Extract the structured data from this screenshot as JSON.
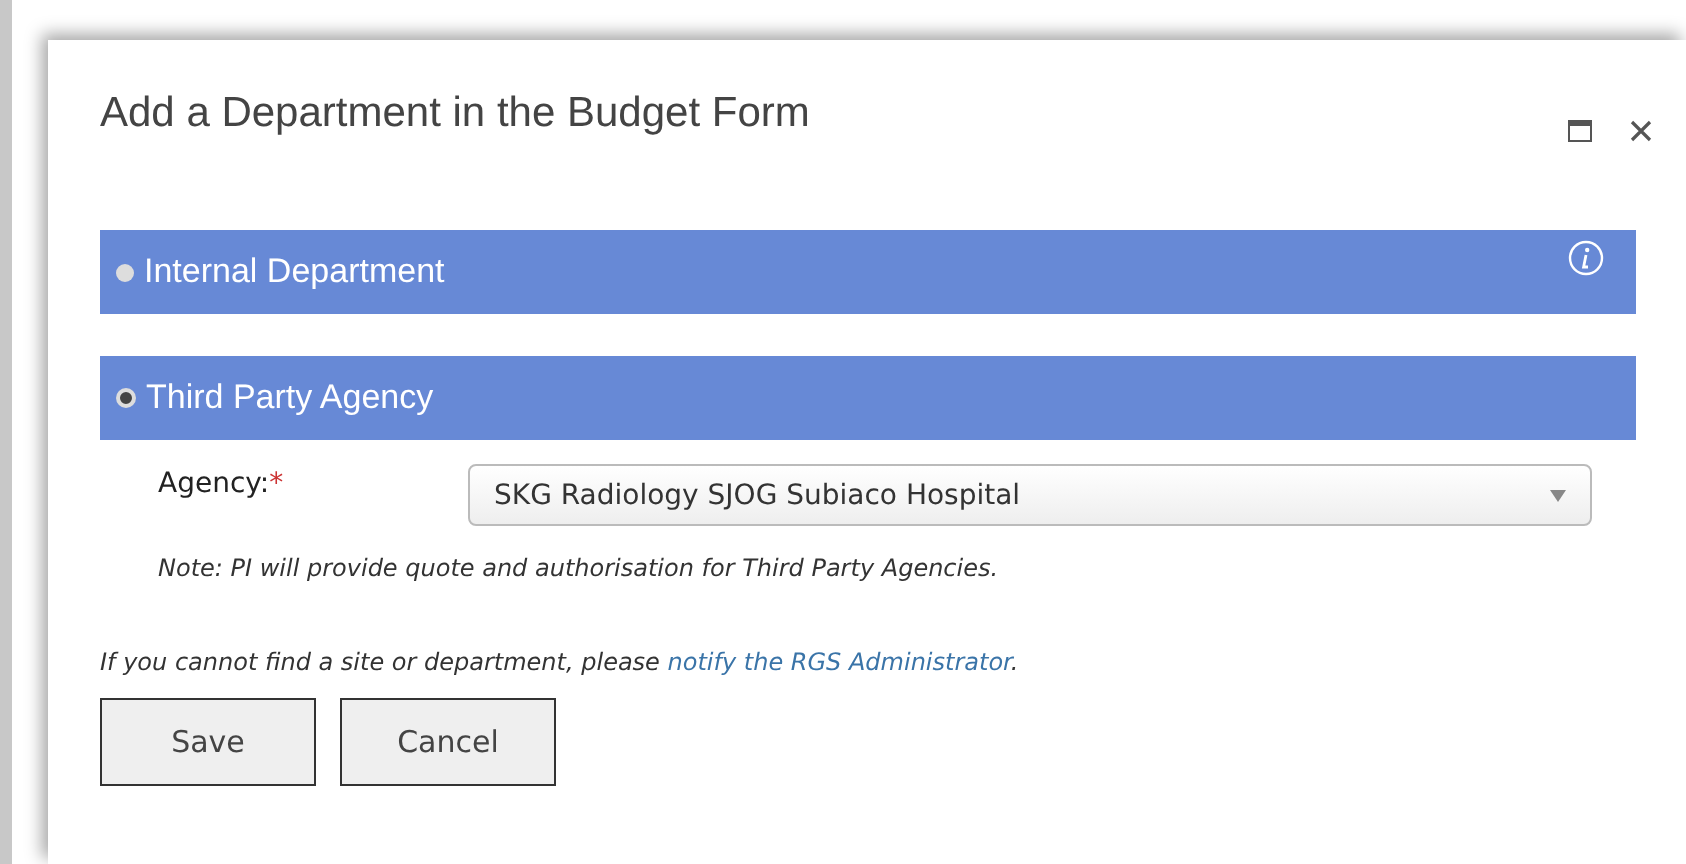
{
  "dialog": {
    "title": "Add a Department in the Budget Form"
  },
  "options": [
    {
      "label": "Internal Department",
      "selected": false,
      "info": true
    },
    {
      "label": "Third Party Agency",
      "selected": true,
      "info": false
    }
  ],
  "agency": {
    "label": "Agency:",
    "required_mark": "*",
    "value": "SKG Radiology SJOG Subiaco Hospital"
  },
  "note": "Note: PI will provide quote and authorisation for Third Party Agencies.",
  "help": {
    "text": "If you cannot find a site or department, please ",
    "link": "notify the RGS Administrator",
    "end": "."
  },
  "buttons": [
    "Save",
    "Cancel"
  ]
}
